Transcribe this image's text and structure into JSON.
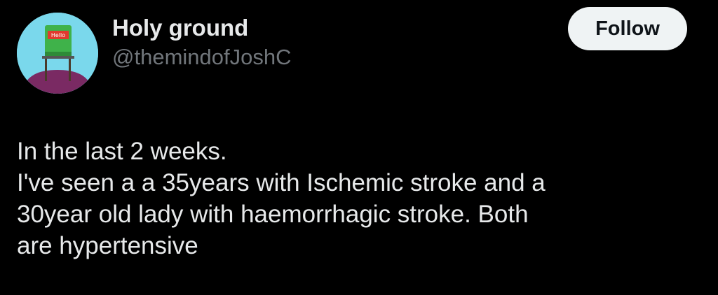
{
  "tweet": {
    "author": {
      "display_name": "Holy ground",
      "handle": "@themindofJoshC",
      "avatar_text": "Hello"
    },
    "follow_label": "Follow",
    "text_lines": [
      "In the last 2 weeks.",
      "I've seen a a 35years with Ischemic stroke and a",
      "30year old lady with haemorrhagic stroke. Both",
      "are hypertensive"
    ]
  },
  "colors": {
    "background": "#000000",
    "text_primary": "#e7e9ea",
    "text_secondary": "#71767b",
    "button_bg": "#eff3f4",
    "button_text": "#0f1419",
    "avatar_bg": "#7ad8ec"
  }
}
